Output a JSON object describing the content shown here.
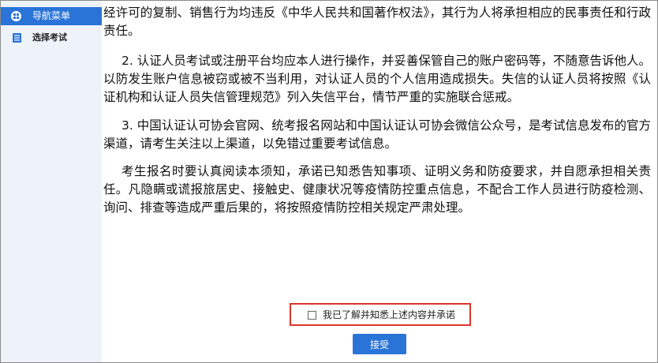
{
  "sidebar": {
    "header_label": "导航菜单",
    "items": [
      {
        "label": "选择考试"
      }
    ]
  },
  "content": {
    "paragraphs": [
      "经许可的复制、销售行为均违反《中华人民共和国著作权法》，其行为人将承担相应的民事责任和行政责任。",
      "2. 认证人员考试或注册平台均应本人进行操作，并妥善保管自己的账户密码等，不随意告诉他人。以防发生账户信息被窃或被不当利用，对认证人员的个人信用造成损失。失信的认证人员将按照《认证机构和认证人员失信管理规范》列入失信平台，情节严重的实施联合惩戒。",
      "3. 中国认证认可协会官网、统考报名网站和中国认证认可协会微信公众号，是考试信息发布的官方渠道，请考生关注以上渠道，以免错过重要考试信息。",
      "考生报名时要认真阅读本须知，承诺已知悉告知事项、证明义务和防疫要求，并自愿承担相关责任。凡隐瞒或谎报旅居史、接触史、健康状况等疫情防控重点信息，不配合工作人员进行防疫检测、询问、排查等造成严重后果的，将按照疫情防控相关规定严肃处理。"
    ]
  },
  "agreement": {
    "checkbox_label": "我已了解并知悉上述内容并承诺",
    "checked": false
  },
  "accept_button": {
    "label": "接受"
  },
  "colors": {
    "accent": "#2a74d8",
    "sidebar_bg": "#eef3fa",
    "highlight_border": "#d9362b"
  }
}
